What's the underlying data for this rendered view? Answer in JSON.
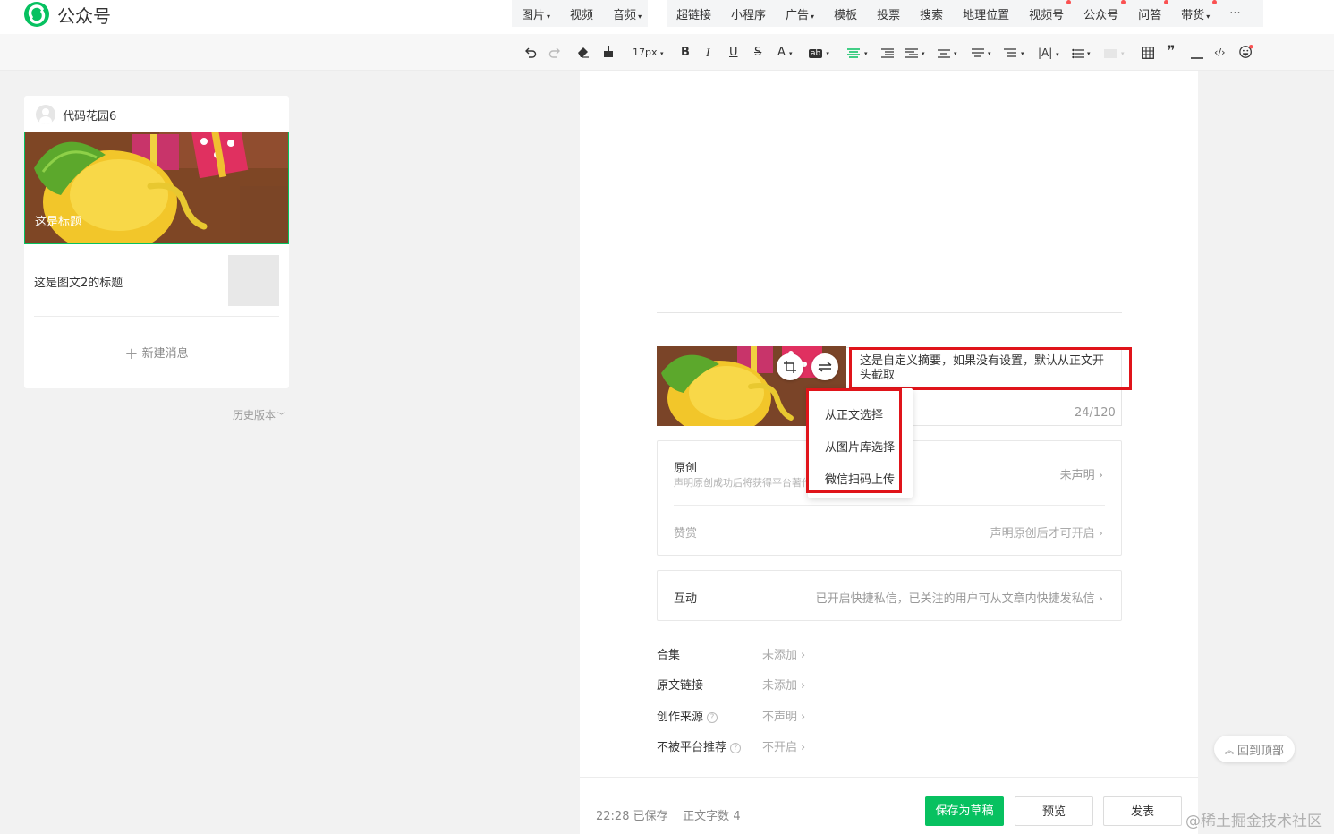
{
  "header": {
    "logo_text": "公众号",
    "insert_group1": [
      {
        "label": "图片",
        "caret": "▾"
      },
      {
        "label": "视频",
        "caret": ""
      },
      {
        "label": "音频",
        "caret": "▾"
      }
    ],
    "insert_group2": [
      {
        "label": "超链接",
        "caret": "",
        "dot": false
      },
      {
        "label": "小程序",
        "caret": "",
        "dot": false
      },
      {
        "label": "广告",
        "caret": "▾",
        "dot": false
      },
      {
        "label": "模板",
        "caret": "",
        "dot": false
      },
      {
        "label": "投票",
        "caret": "",
        "dot": false
      },
      {
        "label": "搜索",
        "caret": "",
        "dot": false
      },
      {
        "label": "地理位置",
        "caret": "",
        "dot": false
      },
      {
        "label": "视频号",
        "caret": "",
        "dot": true
      },
      {
        "label": "公众号",
        "caret": "",
        "dot": true
      },
      {
        "label": "问答",
        "caret": "",
        "dot": true
      },
      {
        "label": "带货",
        "caret": "▾",
        "dot": true
      },
      {
        "label": "···",
        "caret": "",
        "dot": false
      }
    ]
  },
  "toolbar": {
    "font_size": "17px",
    "bold": "B",
    "italic": "I",
    "underline": "U",
    "strike": "S",
    "font_color": "A",
    "bg_color": "ab"
  },
  "sidebar": {
    "account_name": "代码花园6",
    "article1_title": "这是标题",
    "article2_title": "这是图文2的标题",
    "new_message": "新建消息",
    "history": "历史版本"
  },
  "cover": {
    "summary": "这是自定义摘要，如果没有设置，默认从正文开头截取",
    "counter": "24/120",
    "menu": [
      "从正文选择",
      "从图片库选择",
      "微信扫码上传"
    ]
  },
  "settings": {
    "original_label": "原创",
    "original_desc": "声明原创成功后将获得平台著作权保护，文章可被推荐",
    "original_value": "未声明",
    "reward_label": "赞赏",
    "reward_value": "声明原创后才可开启",
    "interact_label": "互动",
    "interact_value": "已开启快捷私信，已关注的用户可从文章内快捷发私信",
    "rows": [
      {
        "label": "合集",
        "value": "未添加",
        "help": false
      },
      {
        "label": "原文链接",
        "value": "未添加",
        "help": false
      },
      {
        "label": "创作来源",
        "value": "不声明",
        "help": true
      },
      {
        "label": "不被平台推荐",
        "value": "不开启",
        "help": true
      }
    ],
    "chevron": "›"
  },
  "footer": {
    "time": "22:28",
    "saved": "已保存",
    "word_count_label": "正文字数",
    "word_count": "4",
    "save_draft": "保存为草稿",
    "preview": "预览",
    "publish": "发表"
  },
  "back_to_top": "回到顶部",
  "watermark": "@稀土掘金技术社区",
  "colors": {
    "brand": "#07c160",
    "highlight": "#e0141a",
    "dot": "#fa5151"
  }
}
